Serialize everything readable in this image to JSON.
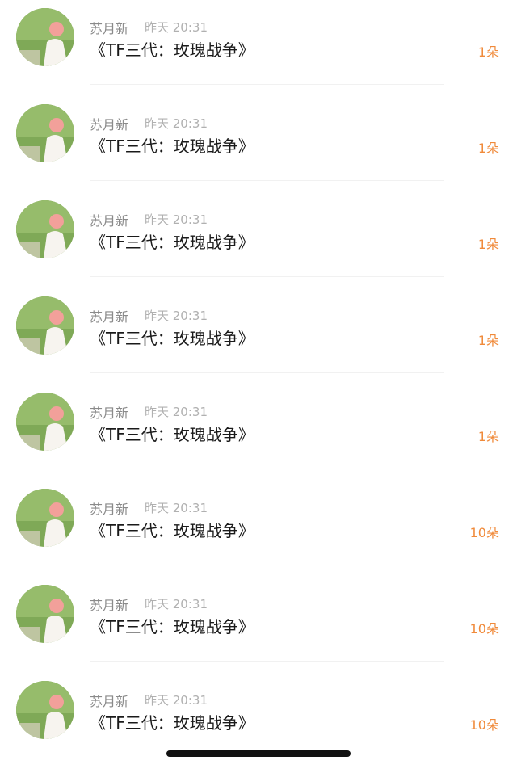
{
  "rows": [
    {
      "name": "苏月新",
      "time": "昨天 20:31",
      "title": "《TF三代：玫瑰战争》",
      "count": "1朵"
    },
    {
      "name": "苏月新",
      "time": "昨天 20:31",
      "title": "《TF三代：玫瑰战争》",
      "count": "1朵"
    },
    {
      "name": "苏月新",
      "time": "昨天 20:31",
      "title": "《TF三代：玫瑰战争》",
      "count": "1朵"
    },
    {
      "name": "苏月新",
      "time": "昨天 20:31",
      "title": "《TF三代：玫瑰战争》",
      "count": "1朵"
    },
    {
      "name": "苏月新",
      "time": "昨天 20:31",
      "title": "《TF三代：玫瑰战争》",
      "count": "1朵"
    },
    {
      "name": "苏月新",
      "time": "昨天 20:31",
      "title": "《TF三代：玫瑰战争》",
      "count": "10朵"
    },
    {
      "name": "苏月新",
      "time": "昨天 20:31",
      "title": "《TF三代：玫瑰战争》",
      "count": "10朵"
    },
    {
      "name": "苏月新",
      "time": "昨天 20:31",
      "title": "《TF三代：玫瑰战争》",
      "count": "10朵"
    }
  ],
  "colors": {
    "name": "#8a8a8a",
    "time": "#b0b0b0",
    "title": "#1a1a1a",
    "count_accent": "#f08a3a",
    "divider": "#f1f1f1"
  },
  "icons": {
    "avatar": "user-avatar-photo"
  }
}
